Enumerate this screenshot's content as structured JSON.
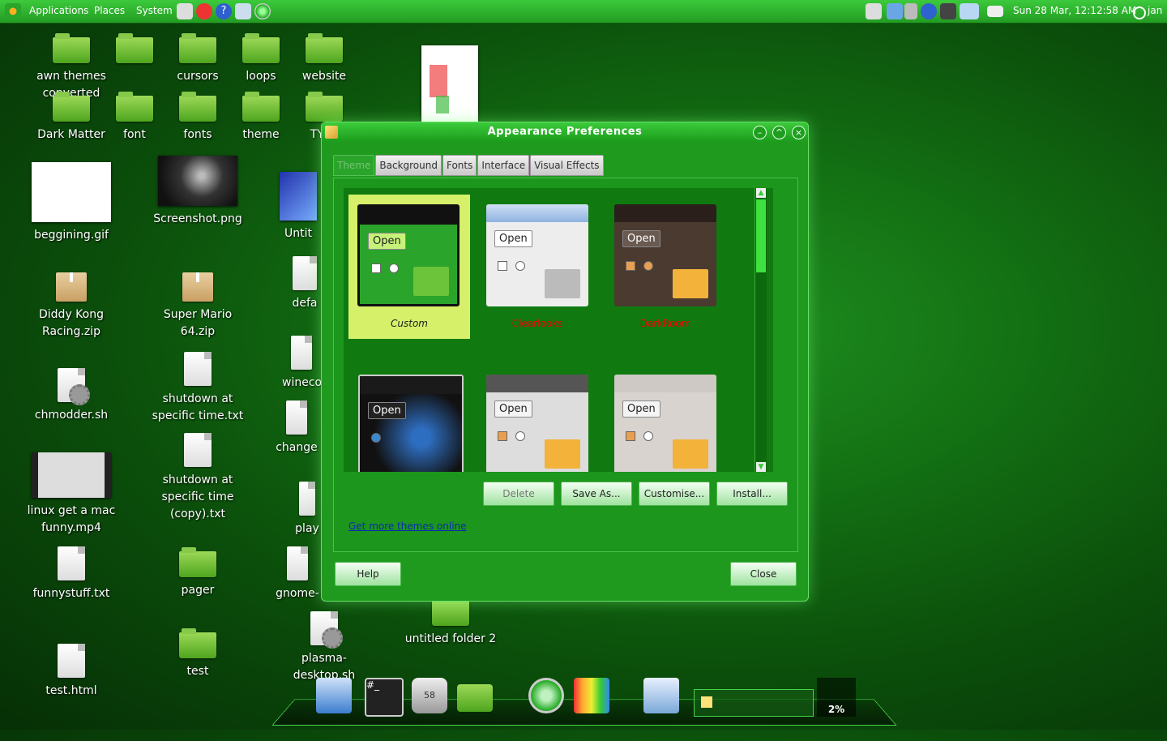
{
  "panel": {
    "applications": "Applications",
    "places": "Places",
    "system": "System",
    "clock": "Sun 28 Mar, 12:12:58 AM",
    "user": "jan"
  },
  "desktop": {
    "awn": "awn themes converted",
    "cursors": "cursors",
    "loops": "loops",
    "website": "website",
    "dark_matter": "Dark Matter",
    "font": "font",
    "fonts": "fonts",
    "theme": "theme",
    "type": "TYPE",
    "beggining": "beggining.gif",
    "screenshot": "Screenshot.png",
    "untit": "Untit",
    "diddy": "Diddy Kong Racing.zip",
    "mario": "Super Mario 64.zip",
    "defa": "defa",
    "chmodder": "chmodder.sh",
    "shutdown1": "shutdown at specific time.txt",
    "wineco": "wineco",
    "shutdown2": "shutdown at specific time (copy).txt",
    "change": "change",
    "linux_mac": "linux get a mac funny.mp4",
    "play": "play",
    "funnystuff": "funnystuff.txt",
    "pager": "pager",
    "gnome": "gnome-",
    "plasma": "plasma-desktop.sh",
    "untitled2": "untitled folder 2",
    "test_html": "test.html",
    "test": "test"
  },
  "dialog": {
    "title": "Appearance Preferences",
    "tabs": [
      "Theme",
      "Background",
      "Fonts",
      "Interface",
      "Visual Effects"
    ],
    "themes": [
      {
        "name": "Custom",
        "open": "Open"
      },
      {
        "name": "Clearlooks",
        "open": "Open"
      },
      {
        "name": "DarkRoom",
        "open": "Open"
      },
      {
        "name": "",
        "open": "Open"
      },
      {
        "name": "",
        "open": "Open"
      },
      {
        "name": "",
        "open": "Open"
      }
    ],
    "buttons": {
      "delete": "Delete",
      "save_as": "Save As...",
      "customise": "Customise...",
      "install": "Install...",
      "help": "Help",
      "close": "Close"
    },
    "more_themes": "Get more themes online"
  },
  "dock": {
    "trash_count": "58",
    "battery": "2%"
  },
  "colors": {
    "accent": "#2aa42a",
    "selected_theme": "#d6f06a",
    "theme_name": "#ee0000"
  }
}
